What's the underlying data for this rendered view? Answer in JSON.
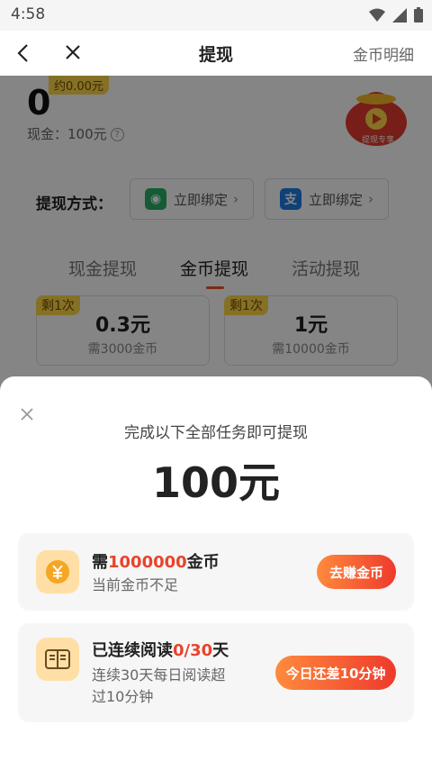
{
  "status_bar": {
    "time": "4:58"
  },
  "topbar": {
    "title": "提现",
    "detail_link": "金币明细"
  },
  "account": {
    "coin_balance": "0",
    "approx_value": "约0.00元",
    "cash_label": "现金：100元",
    "help_icon": "question-circle-icon"
  },
  "promo_bag_label": "提现专享",
  "withdraw_methods": {
    "label": "提现方式：",
    "wechat": {
      "label": "立即绑定",
      "arrow": "›"
    },
    "alipay": {
      "label": "立即绑定",
      "arrow": "›"
    }
  },
  "tabs": [
    {
      "label": "现金提现"
    },
    {
      "label": "金币提现",
      "active": true
    },
    {
      "label": "活动提现"
    }
  ],
  "options": [
    {
      "badge": "剩1次",
      "amount": "0.3元",
      "need": "需3000金币"
    },
    {
      "badge": "剩1次",
      "amount": "1元",
      "need": "需10000金币"
    }
  ],
  "sheet": {
    "heading": "完成以下全部任务即可提现",
    "amount": "100元",
    "tasks": [
      {
        "icon": "yuan-coin-icon",
        "title_prefix": "需",
        "title_highlight": "1000000",
        "title_suffix": "金币",
        "desc_line1": "当前金币不足",
        "desc_line2": "",
        "button": "去赚金币"
      },
      {
        "icon": "book-icon",
        "title_prefix": "已连续阅读",
        "title_highlight": "0/30",
        "title_suffix": "天",
        "desc_line1": "连续30天每日阅读超",
        "desc_line2": "过10分钟",
        "button": "今日还差10分钟"
      }
    ]
  },
  "colors": {
    "accent": "#e8442c",
    "badge": "#ffd84a",
    "wechat": "#2aae67",
    "alipay": "#1e7be6"
  }
}
